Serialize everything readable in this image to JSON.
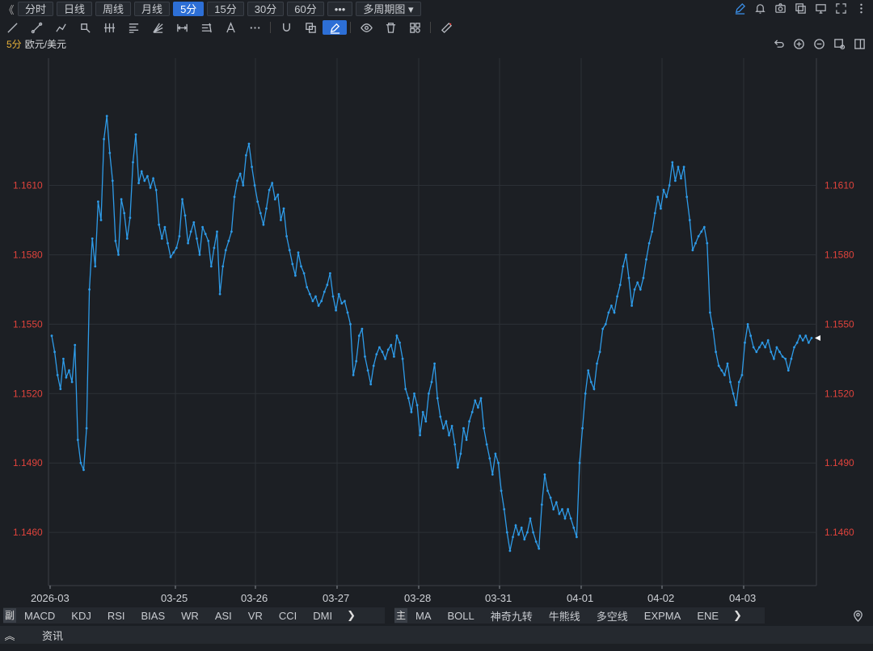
{
  "toolbar": {
    "collapse_glyph": "《",
    "periods": [
      "分时",
      "日线",
      "周线",
      "月线",
      "5分",
      "15分",
      "30分",
      "60分"
    ],
    "active_period": "5分",
    "more_label": "•••",
    "multi_period_label": "多周期图",
    "multi_period_caret": "▾"
  },
  "symbol": {
    "period": "5分",
    "name": "欧元/美元"
  },
  "chart_data": {
    "type": "line",
    "series_color": "#2e9be8",
    "y_ticks": [
      "1.1610",
      "1.1580",
      "1.1550",
      "1.1520",
      "1.1490",
      "1.1460"
    ],
    "y_tick_values": [
      1.161,
      1.158,
      1.155,
      1.152,
      1.149,
      1.146
    ],
    "ylim": [
      1.1437,
      1.1665
    ],
    "x_ticks": [
      "2026-03",
      "03-25",
      "03-26",
      "03-27",
      "03-28",
      "03-31",
      "04-01",
      "04-02",
      "04-03"
    ],
    "grid": true,
    "y": [
      1.1545,
      1.1538,
      1.1528,
      1.1522,
      1.1535,
      1.1527,
      1.153,
      1.1525,
      1.1541,
      1.15,
      1.149,
      1.1487,
      1.1505,
      1.1565,
      1.1587,
      1.1575,
      1.1603,
      1.1595,
      1.163,
      1.164,
      1.1624,
      1.1612,
      1.1586,
      1.158,
      1.1604,
      1.1598,
      1.1587,
      1.1596,
      1.162,
      1.1632,
      1.1611,
      1.1616,
      1.1612,
      1.1614,
      1.1609,
      1.1613,
      1.1608,
      1.1593,
      1.1587,
      1.1592,
      1.1585,
      1.1579,
      1.1581,
      1.1583,
      1.1588,
      1.1604,
      1.1597,
      1.1585,
      1.159,
      1.1594,
      1.1587,
      1.158,
      1.1592,
      1.1589,
      1.1586,
      1.1575,
      1.1583,
      1.159,
      1.1563,
      1.1575,
      1.1582,
      1.1586,
      1.159,
      1.1605,
      1.1612,
      1.1615,
      1.161,
      1.1623,
      1.1628,
      1.1618,
      1.161,
      1.1603,
      1.1598,
      1.1593,
      1.16,
      1.1608,
      1.1611,
      1.1604,
      1.1606,
      1.1595,
      1.16,
      1.1588,
      1.1582,
      1.1576,
      1.1571,
      1.1581,
      1.1575,
      1.1572,
      1.1566,
      1.1563,
      1.156,
      1.1562,
      1.1558,
      1.156,
      1.1564,
      1.1567,
      1.1572,
      1.1562,
      1.1556,
      1.1563,
      1.1559,
      1.156,
      1.1555,
      1.155,
      1.1528,
      1.1534,
      1.1545,
      1.1548,
      1.1536,
      1.153,
      1.1524,
      1.1532,
      1.1537,
      1.154,
      1.1538,
      1.1535,
      1.1539,
      1.1541,
      1.1536,
      1.1545,
      1.1542,
      1.1535,
      1.1522,
      1.1518,
      1.1512,
      1.152,
      1.1515,
      1.1502,
      1.1512,
      1.1508,
      1.152,
      1.1525,
      1.1533,
      1.1518,
      1.151,
      1.1505,
      1.1508,
      1.1502,
      1.1506,
      1.1498,
      1.1488,
      1.1494,
      1.1505,
      1.15,
      1.1508,
      1.1512,
      1.1517,
      1.1514,
      1.1518,
      1.1505,
      1.1498,
      1.1492,
      1.1485,
      1.1494,
      1.149,
      1.1478,
      1.147,
      1.146,
      1.1452,
      1.1458,
      1.1463,
      1.1459,
      1.1462,
      1.1457,
      1.146,
      1.1466,
      1.146,
      1.1456,
      1.1453,
      1.1472,
      1.1485,
      1.1478,
      1.1475,
      1.147,
      1.1473,
      1.1468,
      1.147,
      1.1466,
      1.147,
      1.1466,
      1.1462,
      1.1458,
      1.149,
      1.1505,
      1.152,
      1.153,
      1.1525,
      1.1522,
      1.1533,
      1.1538,
      1.1548,
      1.155,
      1.1555,
      1.1558,
      1.1555,
      1.1562,
      1.1567,
      1.1575,
      1.158,
      1.157,
      1.1558,
      1.1565,
      1.1568,
      1.1565,
      1.157,
      1.1578,
      1.1585,
      1.159,
      1.1598,
      1.1605,
      1.16,
      1.1608,
      1.1605,
      1.161,
      1.162,
      1.1612,
      1.1618,
      1.1613,
      1.1618,
      1.1605,
      1.1595,
      1.1582,
      1.1585,
      1.1588,
      1.159,
      1.1592,
      1.1585,
      1.1555,
      1.1548,
      1.1538,
      1.1532,
      1.153,
      1.1528,
      1.1533,
      1.1525,
      1.152,
      1.1515,
      1.1525,
      1.1528,
      1.1542,
      1.155,
      1.1545,
      1.154,
      1.1538,
      1.154,
      1.1542,
      1.154,
      1.1543,
      1.1538,
      1.1535,
      1.154,
      1.1538,
      1.1536,
      1.1535,
      1.153,
      1.1535,
      1.154,
      1.1542,
      1.1545,
      1.1543,
      1.1545,
      1.1542,
      1.1544
    ]
  },
  "indicators_left": {
    "tag": "副",
    "items": [
      "MACD",
      "KDJ",
      "RSI",
      "BIAS",
      "WR",
      "ASI",
      "VR",
      "CCI",
      "DMI"
    ],
    "more": "❯"
  },
  "indicators_right": {
    "tag": "主",
    "items": [
      "MA",
      "BOLL",
      "神奇九转",
      "牛熊线",
      "多空线",
      "EXPMA",
      "ENE"
    ],
    "more": "❯"
  },
  "news": {
    "toggle": "︽",
    "label": "资讯"
  }
}
